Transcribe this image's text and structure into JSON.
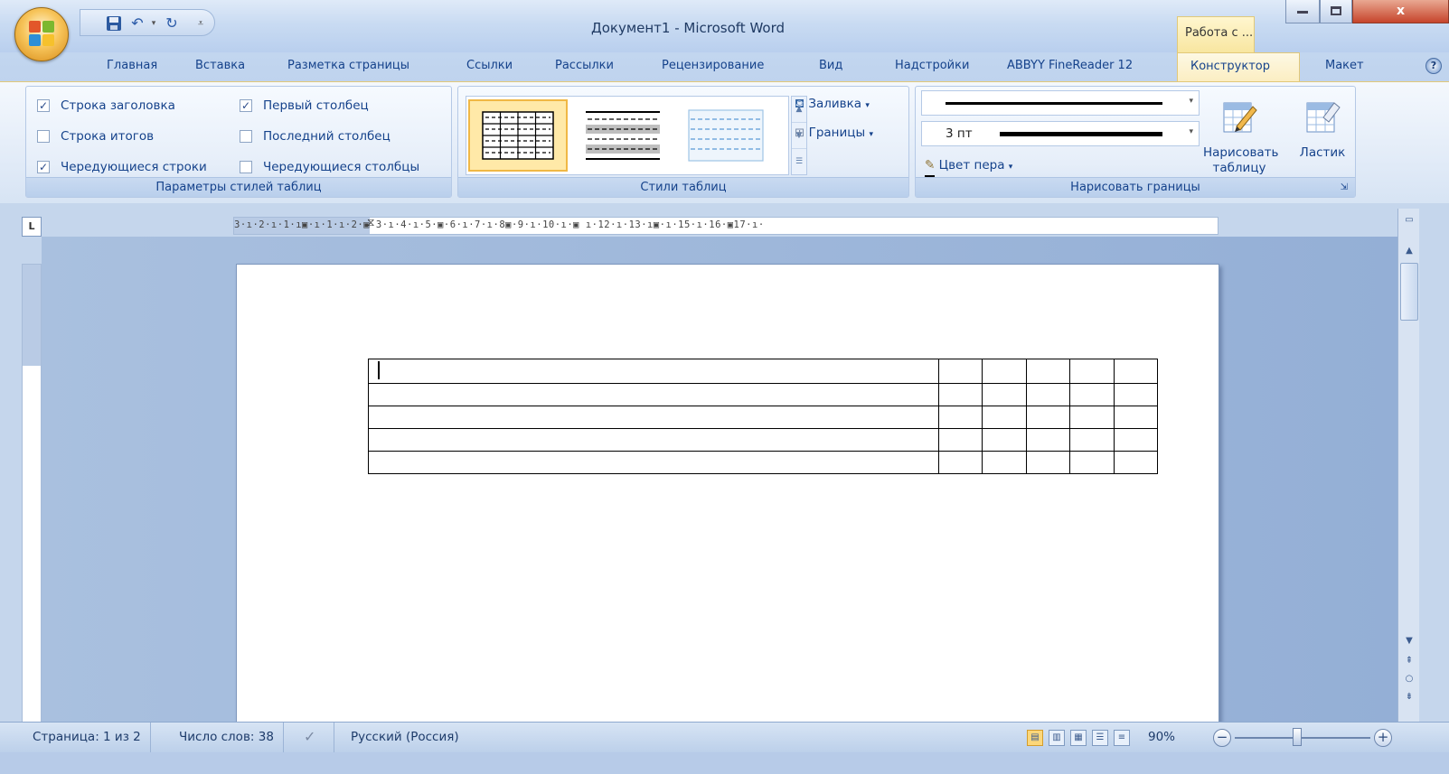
{
  "window": {
    "title": "Документ1 - Microsoft Word",
    "context_tab_title": "Работа с ..."
  },
  "tabs": [
    "Главная",
    "Вставка",
    "Разметка страницы",
    "Ссылки",
    "Рассылки",
    "Рецензирование",
    "Вид",
    "Надстройки",
    "ABBYY FineReader 12",
    "Конструктор",
    "Макет"
  ],
  "active_tab": "Конструктор",
  "ribbon": {
    "group1": {
      "label": "Параметры стилей таблиц",
      "checkboxes": [
        {
          "label": "Строка заголовка",
          "checked": true
        },
        {
          "label": "Строка итогов",
          "checked": false
        },
        {
          "label": "Чередующиеся строки",
          "checked": true
        },
        {
          "label": "Первый столбец",
          "checked": true
        },
        {
          "label": "Последний столбец",
          "checked": false
        },
        {
          "label": "Чередующиеся столбцы",
          "checked": false
        }
      ]
    },
    "group2": {
      "label": "Стили таблиц",
      "shading": "Заливка",
      "borders": "Границы"
    },
    "group3": {
      "label": "Нарисовать границы",
      "pen_weight": "3 пт",
      "pen_color": "Цвет пера",
      "draw_table": "Нарисовать таблицу",
      "eraser": "Ластик"
    }
  },
  "ruler": {
    "horizontal": "3·ı·2·ı·1·ı▣·ı·1·ı·2·▣ 3·ı·4·ı·5·▣·6·ı·7·ı·8▣·9·ı·10·ı·▣ ı·12·ı·13·ı▣·ı·15·ı·16·▣17·ı·",
    "corner": "L"
  },
  "table": {
    "rows": 5,
    "cols": 6
  },
  "status": {
    "page": "Страница: 1 из 2",
    "words": "Число слов: 38",
    "language": "Русский (Россия)",
    "zoom": "90%"
  },
  "colors": {
    "accent": "#15428b",
    "active_tab": "#fbeec2",
    "doc_background": "#9fb7da"
  }
}
